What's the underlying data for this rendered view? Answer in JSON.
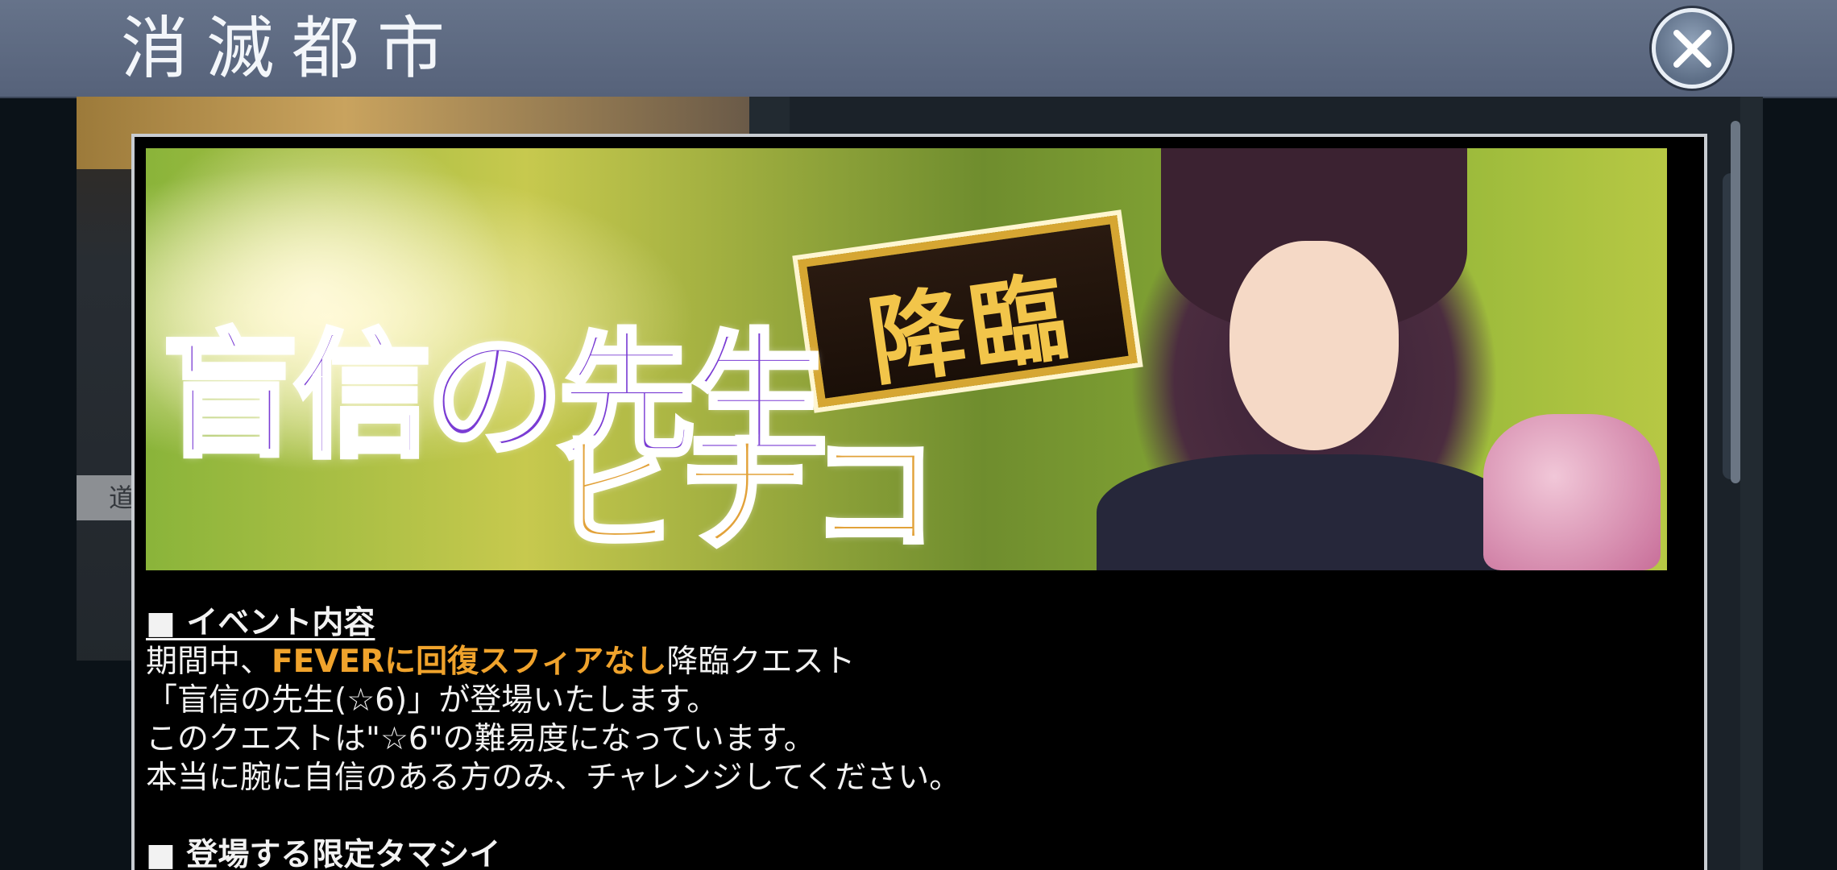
{
  "header": {
    "title": "消滅都市"
  },
  "background": {
    "button_label": "道"
  },
  "modal": {
    "banner": {
      "title_line1": "盲信の先生",
      "title_line2": "ヒナコ",
      "badge": "降臨"
    },
    "sections": [
      {
        "heading": "■ イベント内容",
        "lines": {
          "l1_prefix": "期間中、",
          "l1_highlight": "FEVERに回復スフィアなし",
          "l1_suffix": "降臨クエスト",
          "l2": "「盲信の先生(☆6)」が登場いたします。",
          "l3": "このクエストは\"☆6\"の難易度になっています。",
          "l4": "本当に腕に自信のある方のみ、チャレンジしてください。"
        }
      },
      {
        "heading": "■ 登場する限定タマシイ"
      }
    ]
  },
  "colors": {
    "header_bg": "#5f6b82",
    "highlight": "#f0a32c",
    "modal_bg": "#000000"
  },
  "icons": {
    "close": "close-icon"
  }
}
